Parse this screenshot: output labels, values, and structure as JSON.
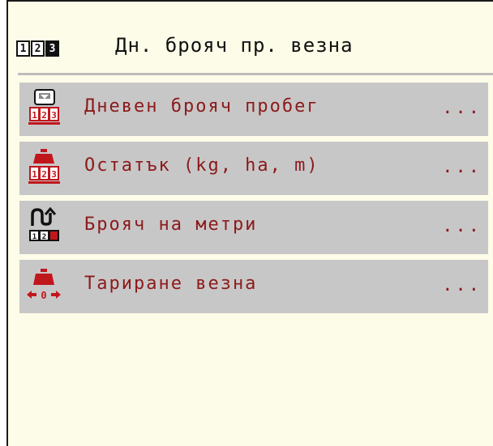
{
  "header": {
    "icon": "counter-123-icon",
    "icon_digits": [
      "1",
      "2",
      "3"
    ],
    "title": "Дн. брояч пр. везна"
  },
  "menu": {
    "items": [
      {
        "icon": "daily-odometer-icon",
        "label": "Дневен брояч пробег",
        "more": "..."
      },
      {
        "icon": "weight-counter-icon",
        "label": "Остатък (kg, ha, m)",
        "more": "..."
      },
      {
        "icon": "meter-counter-icon",
        "label": "Брояч на метри",
        "more": "..."
      },
      {
        "icon": "scale-tare-icon",
        "label": "Тариране везна",
        "more": "..."
      }
    ]
  },
  "colors": {
    "background": "#fdfce8",
    "row_background": "#c8c7c8",
    "label_text": "#8b1a1a",
    "separator": "#bdbdbd"
  }
}
